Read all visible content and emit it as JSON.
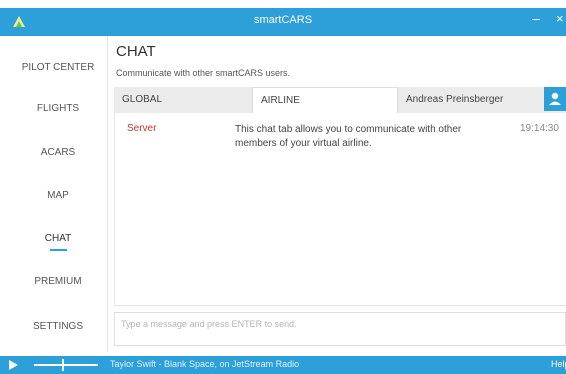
{
  "window": {
    "title": "smartCARS",
    "minimize_glyph": "–",
    "close_glyph": "×"
  },
  "sidebar": {
    "items": [
      {
        "label": "PILOT CENTER",
        "active": false
      },
      {
        "label": "FLIGHTS",
        "active": false
      },
      {
        "label": "ACARS",
        "active": false
      },
      {
        "label": "MAP",
        "active": false
      },
      {
        "label": "CHAT",
        "active": true
      },
      {
        "label": "PREMIUM",
        "active": false
      },
      {
        "label": "SETTINGS",
        "active": false
      }
    ]
  },
  "main": {
    "title": "CHAT",
    "subtitle": "Communicate with other smartCARS users.",
    "tabs": [
      {
        "label": "GLOBAL",
        "active": false
      },
      {
        "label": "AIRLINE",
        "active": true
      },
      {
        "label": "Andreas Preinsberger",
        "active": false
      }
    ],
    "messages": [
      {
        "sender": "Server",
        "text": "This chat tab allows you to communicate with other members of your virtual airline.",
        "time": "19:14:30"
      }
    ],
    "input": {
      "placeholder": "Type a message and press ENTER to send.",
      "value": ""
    }
  },
  "player": {
    "now_playing": "Taylor Swift - Blank Space, on JetStream Radio",
    "volume_fraction": 0.45,
    "help_label": "Help"
  },
  "colors": {
    "accent": "#2d9fd9",
    "sender": "#c0392b",
    "tabbar": "#ebebeb"
  },
  "icons": {
    "logo": "smartcars-logo-icon",
    "user": "user-icon",
    "play": "play-icon"
  }
}
